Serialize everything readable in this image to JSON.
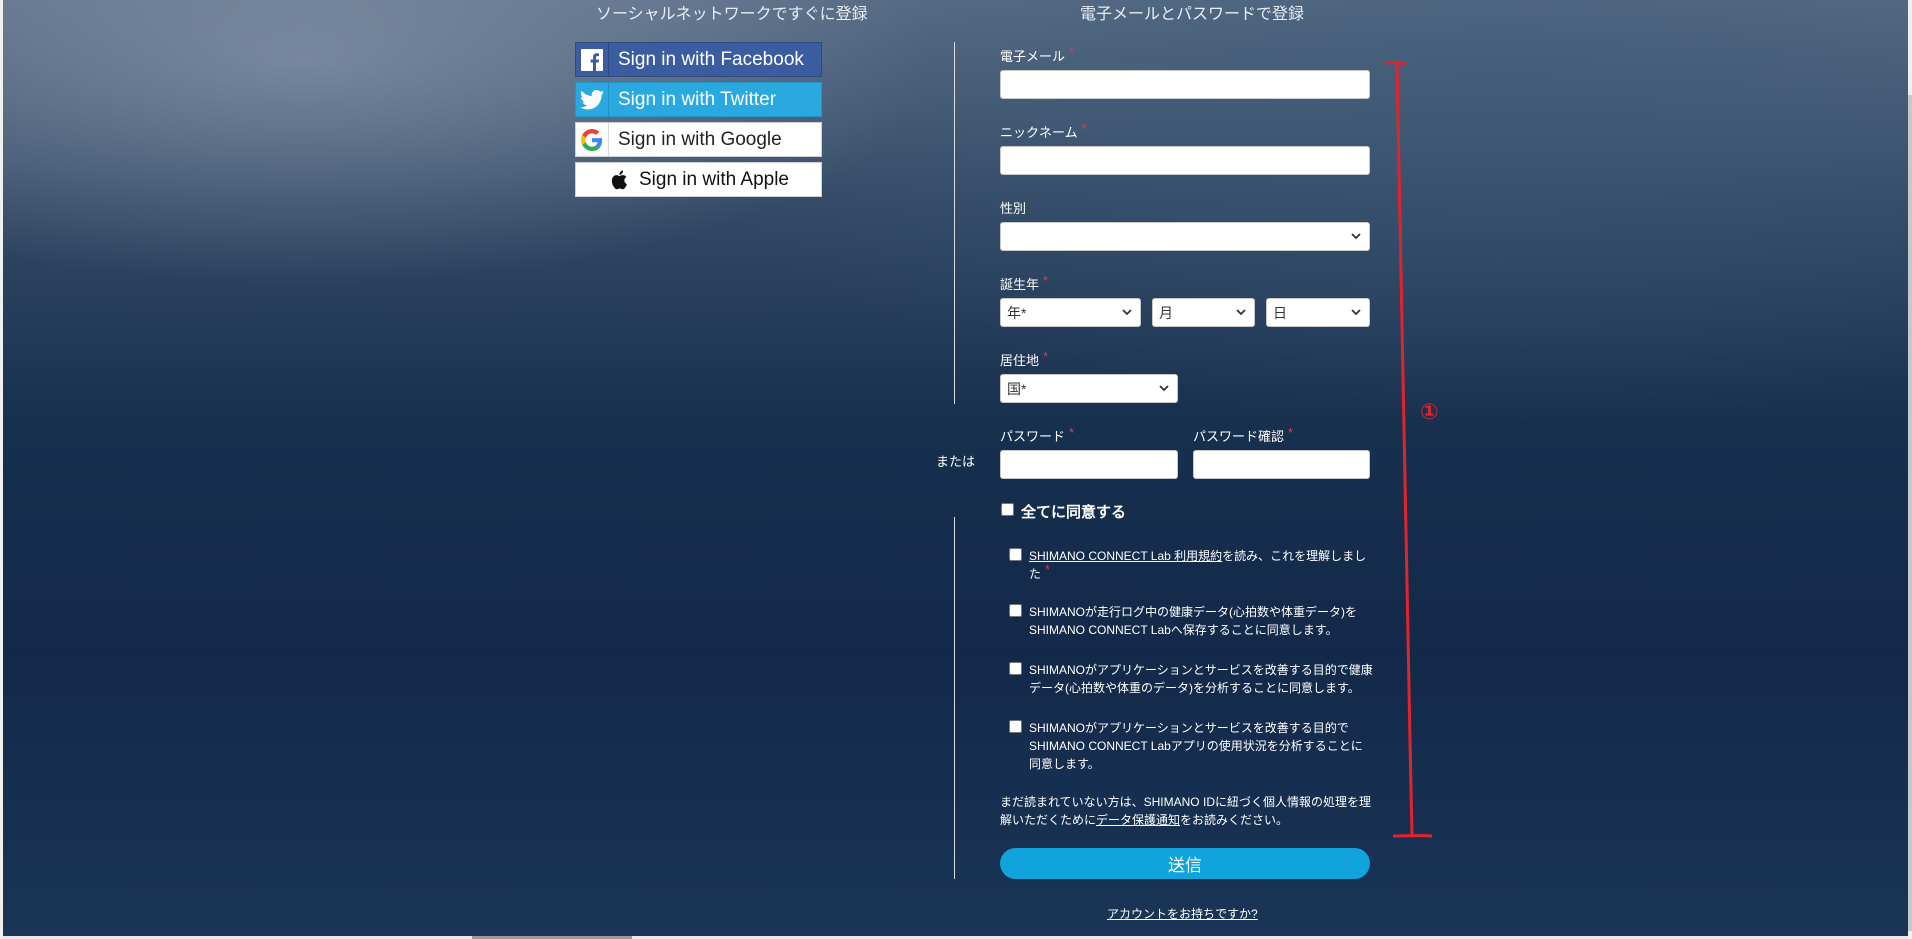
{
  "headings": {
    "social": "ソーシャルネットワークですぐに登録",
    "email": "電子メールとパスワードで登録"
  },
  "social_buttons": {
    "facebook": "Sign in with Facebook",
    "twitter": "Sign in with Twitter",
    "google": "Sign in with Google",
    "apple": "Sign in with Apple"
  },
  "divider_text": "または",
  "form": {
    "email_label": "電子メール",
    "nickname_label": "ニックネーム",
    "gender_label": "性別",
    "birth_label": "誕生年",
    "birth_year_placeholder": "年*",
    "birth_month_placeholder": "月",
    "birth_day_placeholder": "日",
    "residence_label": "居住地",
    "country_placeholder": "国*",
    "password_label": "パスワード",
    "password_confirm_label": "パスワード確認",
    "required_mark": "*"
  },
  "consent": {
    "agree_all": "全てに同意する",
    "terms_link": "SHIMANO CONNECT Lab 利用規約",
    "terms_rest": "を読み、これを理解しました",
    "health_save": "SHIMANOが走行ログ中の健康データ(心拍数や体重データ)をSHIMANO CONNECT Labへ保存することに同意します。",
    "health_analyze": "SHIMANOがアプリケーションとサービスを改善する目的で健康データ(心拍数や体重のデータ)を分析することに同意します。",
    "usage_analyze": "SHIMANOがアプリケーションとサービスを改善する目的でSHIMANO CONNECT Labアプリの使用状況を分析することに同意します。"
  },
  "note": {
    "before": "まだ読まれていない方は、SHIMANO IDに紐づく個人情報の処理を理解いただくために",
    "link": "データ保護通知",
    "after": "をお読みください。"
  },
  "submit_label": "送信",
  "account_link": "アカウントをお持ちですか?",
  "annotation_number": "①",
  "colors": {
    "facebook": "#3b5c9f",
    "twitter": "#2aa9e0",
    "submit": "#10a3dc",
    "required": "#e23b3b",
    "annotation": "#e0242c"
  }
}
